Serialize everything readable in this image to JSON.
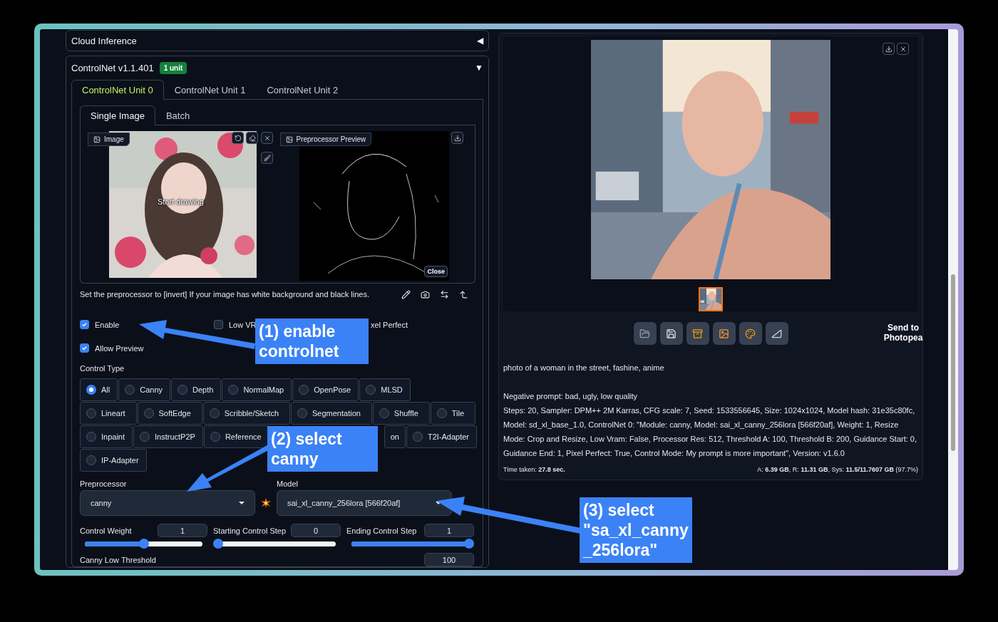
{
  "cloud_inference": {
    "title": "Cloud Inference",
    "toggle": "◀"
  },
  "controlnet": {
    "title": "ControlNet v1.1.401",
    "badge": "1 unit",
    "toggle": "▼",
    "unit_tabs": [
      {
        "label": "ControlNet Unit 0",
        "selected": true
      },
      {
        "label": "ControlNet Unit 1",
        "selected": false
      },
      {
        "label": "ControlNet Unit 2",
        "selected": false
      }
    ],
    "input_tabs": [
      {
        "label": "Single Image",
        "selected": true
      },
      {
        "label": "Batch",
        "selected": false
      }
    ],
    "image_panel": {
      "label": "Image",
      "overlay": "Start drawing"
    },
    "preview_panel": {
      "label": "Preprocessor Preview",
      "close_button": "Close"
    },
    "hint": "Set the preprocessor to [invert] If your image has white background and black lines.",
    "checkboxes": [
      {
        "label": "Enable",
        "checked": true
      },
      {
        "label": "Low VR",
        "checked": false
      },
      {
        "label": "xel Perfect",
        "kind": "partial"
      }
    ],
    "allow_preview": {
      "label": "Allow Preview",
      "checked": true
    },
    "control_type": {
      "label": "Control Type",
      "options": [
        {
          "label": "All",
          "selected": true
        },
        {
          "label": "Canny",
          "selected": false
        },
        {
          "label": "Depth",
          "selected": false
        },
        {
          "label": "NormalMap",
          "selected": false
        },
        {
          "label": "OpenPose",
          "selected": false
        },
        {
          "label": "MLSD",
          "selected": false
        },
        {
          "label": "Lineart",
          "selected": false
        },
        {
          "label": "SoftEdge",
          "selected": false
        },
        {
          "label": "Scribble/Sketch",
          "selected": false
        },
        {
          "label": "Segmentation",
          "selected": false
        },
        {
          "label": "Shuffle",
          "selected": false
        },
        {
          "label": "Tile",
          "selected": false
        },
        {
          "label": "Inpaint",
          "selected": false
        },
        {
          "label": "InstructP2P",
          "selected": false
        },
        {
          "label": "Reference",
          "selected": false
        },
        {
          "label": "on",
          "kind": "partial"
        },
        {
          "label": "T2I-Adapter",
          "selected": false
        },
        {
          "label": "IP-Adapter",
          "selected": false
        }
      ]
    },
    "preprocessor": {
      "label": "Preprocessor",
      "value": "canny"
    },
    "model": {
      "label": "Model",
      "value": "sai_xl_canny_256lora [566f20af]"
    },
    "sliders": [
      {
        "label": "Control Weight",
        "value": "1",
        "level": 0.5
      },
      {
        "label": "Starting Control Step",
        "value": "0",
        "level": 0
      },
      {
        "label": "Ending Control Step",
        "value": "1",
        "level": 1
      }
    ],
    "canny_low_threshold": {
      "label": "Canny Low Threshold",
      "value": "100"
    }
  },
  "output": {
    "send_button": "Send to Photopea",
    "prompt": "photo of a woman in the street, fashine, anime",
    "negative_prompt": "Negative prompt: bad, ugly, low quality",
    "parameters": "Steps: 20, Sampler: DPM++ 2M Karras, CFG scale: 7, Seed: 1533556645, Size: 1024x1024, Model hash: 31e35c80fc, Model: sd_xl_base_1.0, ControlNet 0: \"Module: canny, Model: sai_xl_canny_256lora [566f20af], Weight: 1, Resize Mode: Crop and Resize, Low Vram: False, Processor Res: 512, Threshold A: 100, Threshold B: 200, Guidance Start: 0, Guidance End: 1, Pixel Perfect: True, Control Mode: My prompt is more important\", Version: v1.6.0",
    "time_taken": "Time taken: **27.8 sec.**",
    "memory": "A: **6.39 GB**, R: **11.31 GB**, Sys: **11.5/11.7607 GB** (97.7%)"
  },
  "annotations": [
    {
      "text": "(1) enable controlnet"
    },
    {
      "text": "(2) select canny"
    },
    {
      "text": "(3) select \"sa_xl_canny_256lora\""
    }
  ]
}
